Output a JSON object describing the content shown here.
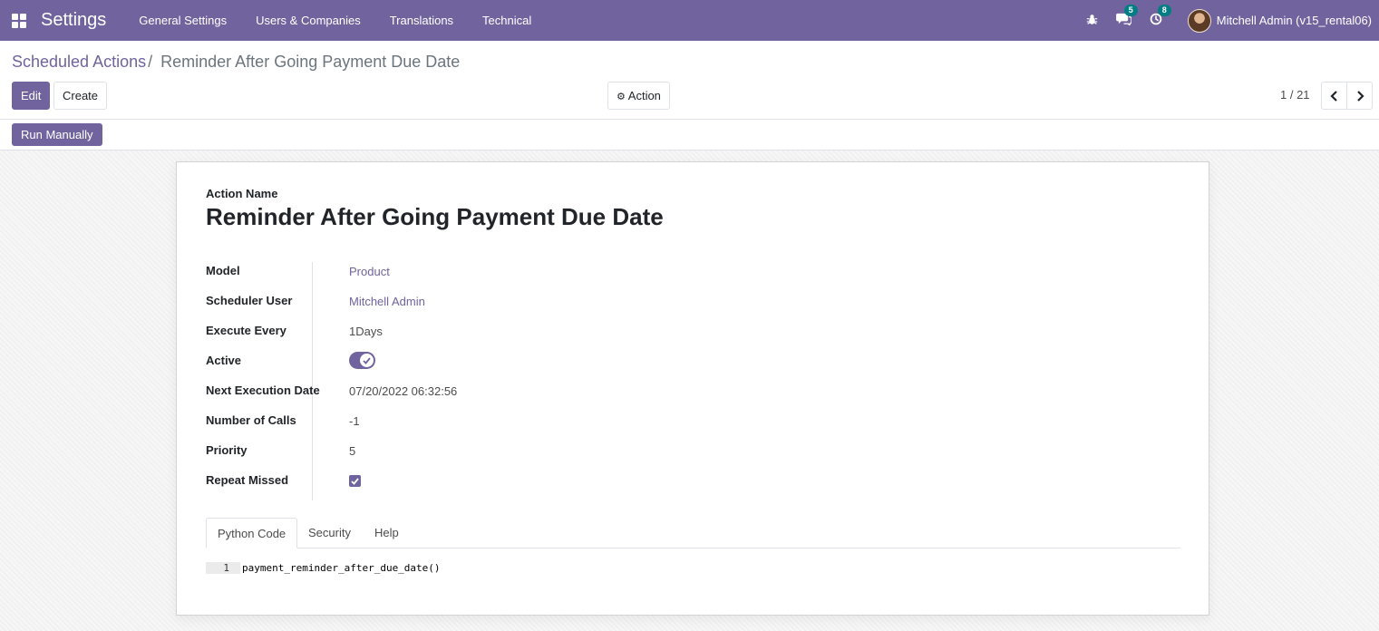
{
  "navbar": {
    "app_name": "Settings",
    "menu": [
      "General Settings",
      "Users & Companies",
      "Translations",
      "Technical"
    ],
    "messages_count": "5",
    "activities_count": "8",
    "user_name": "Mitchell Admin (v15_rental06)",
    "background_color": "#71639e"
  },
  "breadcrumb": {
    "parent": "Scheduled Actions",
    "separator": "/",
    "current": "Reminder After Going Payment Due Date"
  },
  "toolbar": {
    "edit_label": "Edit",
    "create_label": "Create",
    "action_label": "Action",
    "pager_value": "1 / 21"
  },
  "statusbar": {
    "run_manually_label": "Run Manually"
  },
  "form": {
    "name_label": "Action Name",
    "name_value": "Reminder After Going Payment Due Date",
    "fields": {
      "model": {
        "label": "Model",
        "value": "Product"
      },
      "scheduler_user": {
        "label": "Scheduler User",
        "value": "Mitchell Admin"
      },
      "execute_every": {
        "label": "Execute Every",
        "value": "1Days"
      },
      "active": {
        "label": "Active",
        "value": true
      },
      "next_execution_date": {
        "label": "Next Execution Date",
        "value": "07/20/2022 06:32:56"
      },
      "number_of_calls": {
        "label": "Number of Calls",
        "value": "-1"
      },
      "priority": {
        "label": "Priority",
        "value": "5"
      },
      "repeat_missed": {
        "label": "Repeat Missed",
        "value": true
      }
    },
    "tabs": [
      "Python Code",
      "Security",
      "Help"
    ],
    "active_tab": "Python Code",
    "code": {
      "line_number": "1",
      "line": "payment_reminder_after_due_date()"
    }
  },
  "colors": {
    "accent": "#71639e",
    "badge": "#017e84"
  }
}
